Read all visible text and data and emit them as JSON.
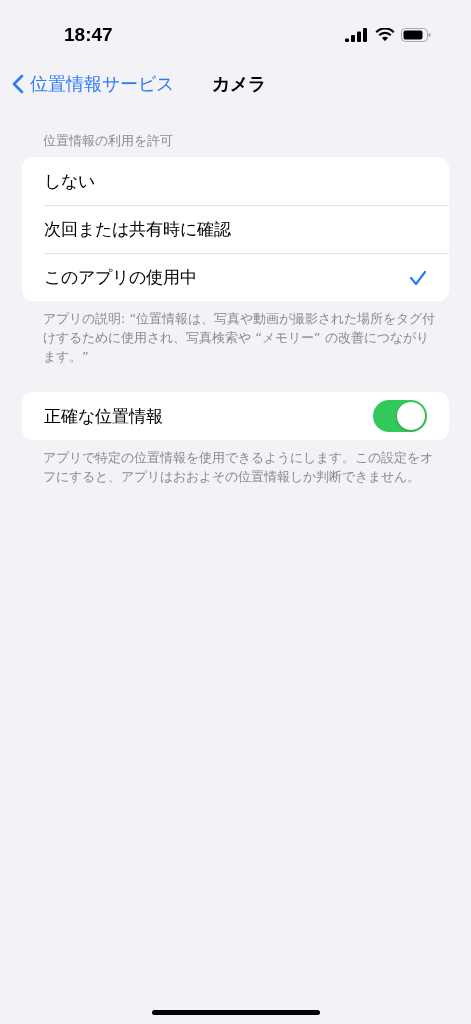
{
  "status_bar": {
    "time": "18:47"
  },
  "nav": {
    "back": "位置情報サービス",
    "title": "カメラ"
  },
  "permission": {
    "header": "位置情報の利用を許可",
    "options": [
      {
        "label": "しない",
        "selected": false
      },
      {
        "label": "次回または共有時に確認",
        "selected": false
      },
      {
        "label": "このアプリの使用中",
        "selected": true
      }
    ],
    "footer": "アプリの説明: “位置情報は、写真や動画が撮影された場所をタグ付けするために使用され、写真検索や “メモリー” の改善につながります。”"
  },
  "precise": {
    "label": "正確な位置情報",
    "on": true,
    "footer": "アプリで特定の位置情報を使用できるようにします。この設定をオフにすると、アプリはおおよその位置情報しか判断できません。"
  }
}
